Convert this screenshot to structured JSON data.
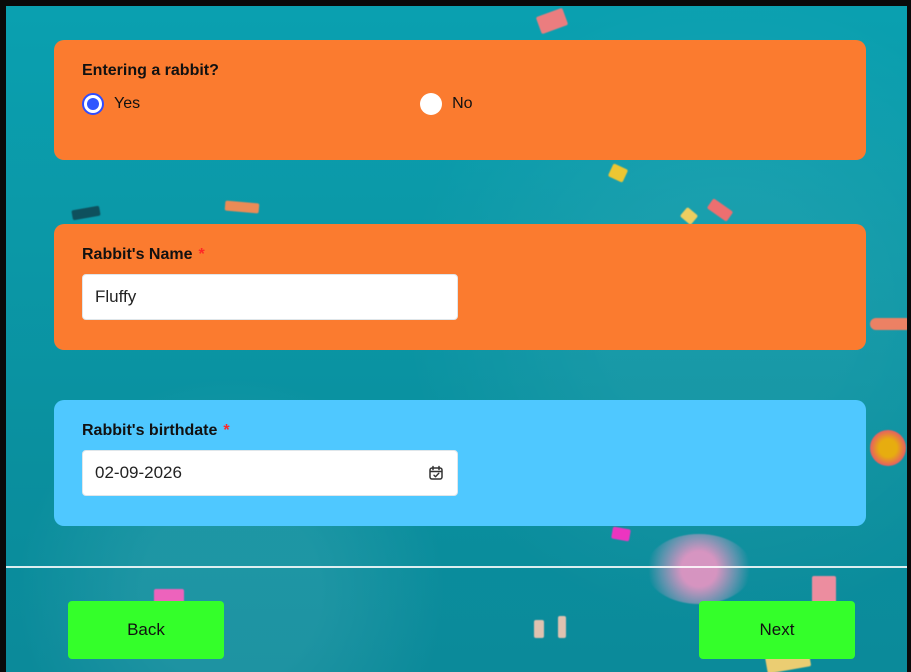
{
  "rabbit_question": {
    "title": "Entering a rabbit?",
    "options": [
      {
        "label": "Yes",
        "checked": true
      },
      {
        "label": "No",
        "checked": false
      }
    ]
  },
  "rabbit_name": {
    "label": "Rabbit's Name",
    "required_mark": "*",
    "value": "Fluffy"
  },
  "rabbit_birthdate": {
    "label": "Rabbit's birthdate",
    "required_mark": "*",
    "value": "02-09-2026",
    "icon": "calendar-icon"
  },
  "navigation": {
    "back_label": "Back",
    "next_label": "Next"
  },
  "colors": {
    "background": "#0b98a7",
    "orange_card": "#fb7b2f",
    "blue_card": "#4fc8ff",
    "button": "#34ff2a",
    "required": "#ff2727",
    "radio_selected": "#2f56ff"
  }
}
